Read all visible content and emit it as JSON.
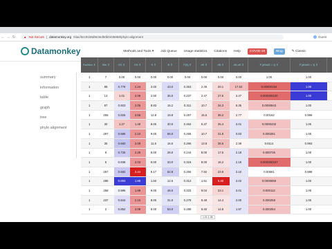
{
  "browser": {
    "security_label": "Not Secure",
    "url_host": "datamonkey.org",
    "url_path": "/slac/5ec9158d9e3ed50b0436868/phylo-alignment",
    "profile_label": "Guest"
  },
  "site": {
    "logo_text": "Datamonkey",
    "nav": [
      {
        "label": "Methods and Tools ▾"
      },
      {
        "label": "Job Queue"
      },
      {
        "label": "Usage statistics"
      },
      {
        "label": "Citations"
      },
      {
        "label": "Help"
      },
      {
        "label": "COVID-19",
        "style": "red"
      },
      {
        "label": "Blog",
        "style": "blue"
      },
      {
        "label": "✎ Classic"
      }
    ]
  },
  "sidebar": {
    "items": [
      {
        "label": "summary"
      },
      {
        "label": "information"
      },
      {
        "label": "table"
      },
      {
        "label": "graph"
      },
      {
        "label": "tree"
      },
      {
        "label": "phylo alignment"
      }
    ]
  },
  "table": {
    "headers": [
      "Partition ⇕",
      "Site ⇕",
      "ES ⇕",
      "EN ⇕",
      "S ⇕",
      "N ⇕",
      "P[S] ⇕",
      "dS ⇕",
      "dN ⇕",
      "dN-dS ⇕",
      "P [dN/dS > 1] ⇕",
      "P [dN/dS < 1] ⇕",
      "Total branch length ⇕"
    ],
    "rows": [
      [
        "1",
        "7",
        "0.00",
        "0.00",
        "0.00",
        "0.00",
        "0.00",
        "0.00",
        "0.00",
        "0.00",
        "1.00",
        "1.00",
        "7.48"
      ],
      [
        "1",
        "89",
        "0.778",
        "2.24",
        "2.00",
        "43.0",
        "0.353",
        "2.45",
        "20.1",
        "17.62",
        "0.00000154",
        "1.00",
        "7.22"
      ],
      [
        "1",
        "13",
        "1.01",
        "2.09",
        "2.50",
        "35.5",
        "0.237",
        "2.47",
        "27.5",
        "3.47",
        "0.000000120",
        "1.00",
        "7.22"
      ],
      [
        "1",
        "87",
        "0.923",
        "2.05",
        "8.83",
        "15.2",
        "0.311",
        "10.7",
        "34.3",
        "6.35",
        "0.0000843",
        "1.00",
        "7.48"
      ],
      [
        "1",
        "255",
        "0.826",
        "2.65",
        "12.8",
        "19.8",
        "0.297",
        "15.5",
        "36.2",
        "2.77",
        "0.00162",
        "0.999",
        "7.48"
      ],
      [
        "1",
        "30",
        "1.27",
        "1.48",
        "8.00",
        "30.0",
        "0.462",
        "6.37",
        "26.4",
        "2.01",
        "0.0000432",
        "1.00",
        "7.40"
      ],
      [
        "1",
        "297",
        "0.686",
        "2.10",
        "9.00",
        "66.0",
        "0.265",
        "10.7",
        "31.8",
        "0.83",
        "0.000281",
        "1.00",
        "7.48"
      ],
      [
        "1",
        "35",
        "0.660",
        "2.09",
        "11.5",
        "16.5",
        "0.266",
        "13.8",
        "35.6",
        "2.39",
        "0.0114",
        "0.993",
        "7.38"
      ],
      [
        "1",
        "6",
        "0.725",
        "2.25",
        "8.00",
        "28.0",
        "0.244",
        "8.00",
        "17.5",
        "2.18",
        "0.000736",
        "1.00",
        "7.48"
      ],
      [
        "1",
        "5",
        "0.938",
        "2.03",
        "9.00",
        "33.0",
        "0.316",
        "8.00",
        "16.2",
        "2.18",
        "0.000000107",
        "1.00",
        "7.48"
      ],
      [
        "1",
        "257",
        "0.682",
        "2.24",
        "5.17",
        "52.8",
        "0.256",
        "7.92",
        "23.6",
        "2.10",
        "0.00661",
        "0.998",
        "7.48"
      ],
      [
        "1",
        "286",
        "0.893",
        "1.99",
        "1.50",
        "12.5",
        "0.312",
        "1.51",
        "6.40",
        "2.02",
        "0.0000659",
        "1.00",
        "7.25"
      ],
      [
        "1",
        "258",
        "0.996",
        "1.99",
        "9.00",
        "46.0",
        "0.333",
        "9.04",
        "23.1",
        "2.01",
        "0.000112",
        "1.00",
        "7.48"
      ],
      [
        "1",
        "237",
        "0.844",
        "2.16",
        "8.00",
        "31.0",
        "0.278",
        "9.48",
        "14.4",
        "2.00",
        "0.000258",
        "1.00",
        "7.48"
      ],
      [
        "1",
        "2",
        "0.852",
        "2.09",
        "8.00",
        "53.0",
        "0.289",
        "9.40",
        "14.8",
        "1.97",
        "0.000254",
        "1.00",
        "7.27"
      ]
    ],
    "highlight_color": "#3b3bd6",
    "hot_color": "#d81e1e",
    "tooltip": "1.21 1.35"
  }
}
